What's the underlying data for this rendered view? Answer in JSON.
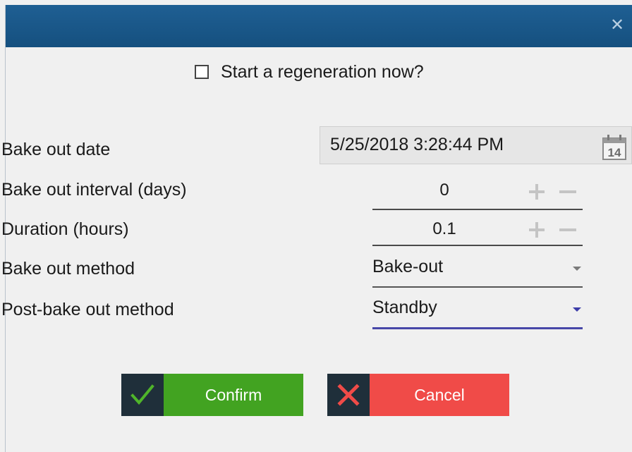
{
  "window": {
    "close_symbol": "✕"
  },
  "regen": {
    "label": "Start a regeneration now?",
    "checked": false
  },
  "fields": {
    "bake_out_date": {
      "label": "Bake out date",
      "value": "5/25/2018 3:28:44 PM",
      "calendar_day": "14"
    },
    "interval": {
      "label": "Bake out interval (days)",
      "value": "0"
    },
    "duration": {
      "label": "Duration (hours)",
      "value": "0.1"
    },
    "method": {
      "label": "Bake out method",
      "value": "Bake-out"
    },
    "post_method": {
      "label": "Post-bake out method",
      "value": "Standby"
    }
  },
  "buttons": {
    "confirm": "Confirm",
    "cancel": "Cancel"
  },
  "icons": {
    "close": "close-icon",
    "checkbox": "checkbox-icon",
    "calendar": "calendar-icon",
    "plus": "plus-icon",
    "minus": "minus-icon",
    "dropdown": "chevron-down-icon",
    "check": "checkmark-icon",
    "x": "x-icon"
  },
  "colors": {
    "titlebar": "#1f5f93",
    "confirm": "#42a321",
    "cancel": "#f04b48",
    "icon_box": "#1f2f3a",
    "active_underline": "#4747a8"
  }
}
